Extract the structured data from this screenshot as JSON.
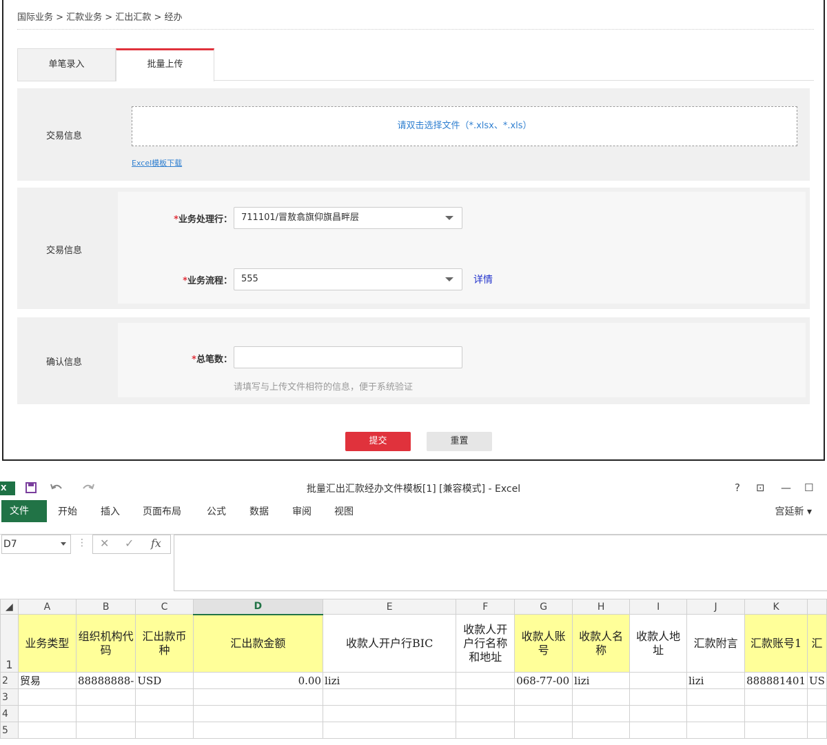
{
  "web": {
    "breadcrumb": "国际业务 > 汇款业务 > 汇出汇款 > 经办",
    "tabs": [
      "单笔录入",
      "批量上传"
    ],
    "section1": {
      "label": "交易信息",
      "dropzone": "请双击选择文件（*.xlsx、*.xls）",
      "template_link": "Excel模板下载"
    },
    "section2": {
      "label": "交易信息",
      "branch_label": "业务处理行：",
      "branch_value": "711101/冒敖翕旗仰旗昌畔层",
      "flow_label": "业务流程：",
      "flow_value": "555",
      "detail_link": "详情"
    },
    "section3": {
      "label": "确认信息",
      "count_label": "总笔数：",
      "count_value": "",
      "hint": "请填写与上传文件相符的信息，便于系统验证"
    },
    "required_mark": "*",
    "submit": "提交",
    "reset": "重置"
  },
  "excel": {
    "title": "批量汇出汇款经办文件模板[1]  [兼容模式] - Excel",
    "logo": "X",
    "quick_access": [
      "save-icon",
      "undo-icon",
      "redo-icon"
    ],
    "window_controls": [
      "?",
      "⊡",
      "—",
      "☐"
    ],
    "ribbon_tabs": [
      "文件",
      "开始",
      "插入",
      "页面布局",
      "公式",
      "数据",
      "审阅",
      "视图"
    ],
    "user": "宫延新",
    "name_box": "D7",
    "fx": "fx",
    "columns": [
      "A",
      "B",
      "C",
      "D",
      "E",
      "F",
      "G",
      "H",
      "I",
      "J",
      "K",
      "汇"
    ],
    "header_row": [
      "业务类型",
      "组织机构代码",
      "汇出款币种",
      "汇出款金额",
      "收款人开户行BIC",
      "收款人开户行名称和地址",
      "收款人账号",
      "收款人名称",
      "收款人地址",
      "汇款附言",
      "汇款账号1",
      "汇"
    ],
    "row2": [
      "贸易",
      "88888888-",
      "USD",
      "0.00",
      "lizi",
      "",
      "068-77-00",
      "lizi",
      "",
      "lizi",
      "888881401",
      "US"
    ],
    "row_numbers": [
      "1",
      "2",
      "3",
      "4",
      "5"
    ],
    "accent": "#217346",
    "highlight": "#ffff99"
  }
}
